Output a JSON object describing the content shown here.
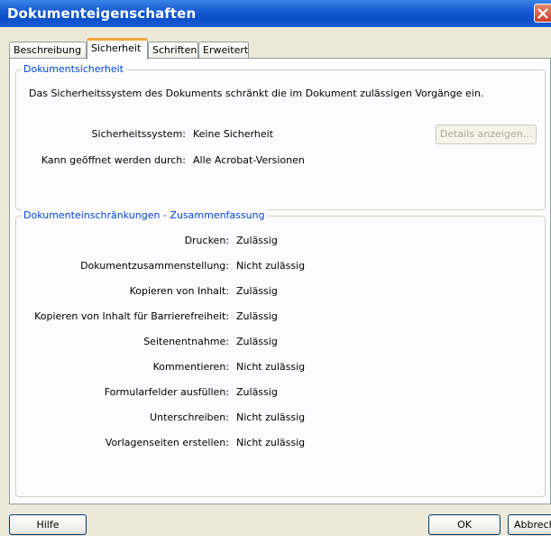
{
  "window": {
    "title": "Dokumenteigenschaften"
  },
  "tabs": [
    {
      "label": "Beschreibung",
      "active": false
    },
    {
      "label": "Sicherheit",
      "active": true
    },
    {
      "label": "Schriften",
      "active": false
    },
    {
      "label": "Erweitert",
      "active": false
    }
  ],
  "security": {
    "group_label": "Dokumentsicherheit",
    "description": "Das Sicherheitssystem des Dokuments schränkt die im Dokument zulässigen Vorgänge ein.",
    "system_label": "Sicherheitssystem:",
    "system_value": "Keine Sicherheit",
    "details_button": "Details anzeigen...",
    "opened_by_label": "Kann geöffnet werden durch:",
    "opened_by_value": "Alle Acrobat-Versionen"
  },
  "restrictions": {
    "group_label": "Dokumenteinschränkungen - Zusammenfassung",
    "rows": [
      {
        "label": "Drucken:",
        "value": "Zulässig"
      },
      {
        "label": "Dokumentzusammenstellung:",
        "value": "Nicht zulässig"
      },
      {
        "label": "Kopieren von Inhalt:",
        "value": "Zulässig"
      },
      {
        "label": "Kopieren von Inhalt für Barrierefreiheit:",
        "value": "Zulässig"
      },
      {
        "label": "Seitenentnahme:",
        "value": "Zulässig"
      },
      {
        "label": "Kommentieren:",
        "value": "Nicht zulässig"
      },
      {
        "label": "Formularfelder ausfüllen:",
        "value": "Zulässig"
      },
      {
        "label": "Unterschreiben:",
        "value": "Nicht zulässig"
      },
      {
        "label": "Vorlagenseiten erstellen:",
        "value": "Nicht zulässig"
      }
    ]
  },
  "footer": {
    "help_button": "Hilfe",
    "ok_button": "OK",
    "cancel_button": "Abbrechen"
  },
  "colors": {
    "accent": "#0046d5",
    "title_bar": "#0a4fc9",
    "tab_highlight": "#f2a43c"
  }
}
